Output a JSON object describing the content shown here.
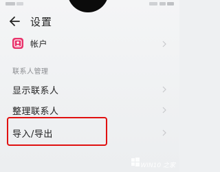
{
  "header": {
    "title": "设置",
    "back_icon": "arrow-left-icon"
  },
  "account": {
    "label": "帐户",
    "icon": "contact-card-icon",
    "icon_color": "#e8336b"
  },
  "contacts_section": {
    "title": "联系人管理",
    "items": [
      {
        "label": "显示联系人"
      },
      {
        "label": "整理联系人"
      },
      {
        "label": "导入/导出"
      }
    ]
  },
  "highlight_color": "#e01010",
  "watermark": {
    "logo": "windows-logo",
    "text": "WIN10 之家"
  }
}
